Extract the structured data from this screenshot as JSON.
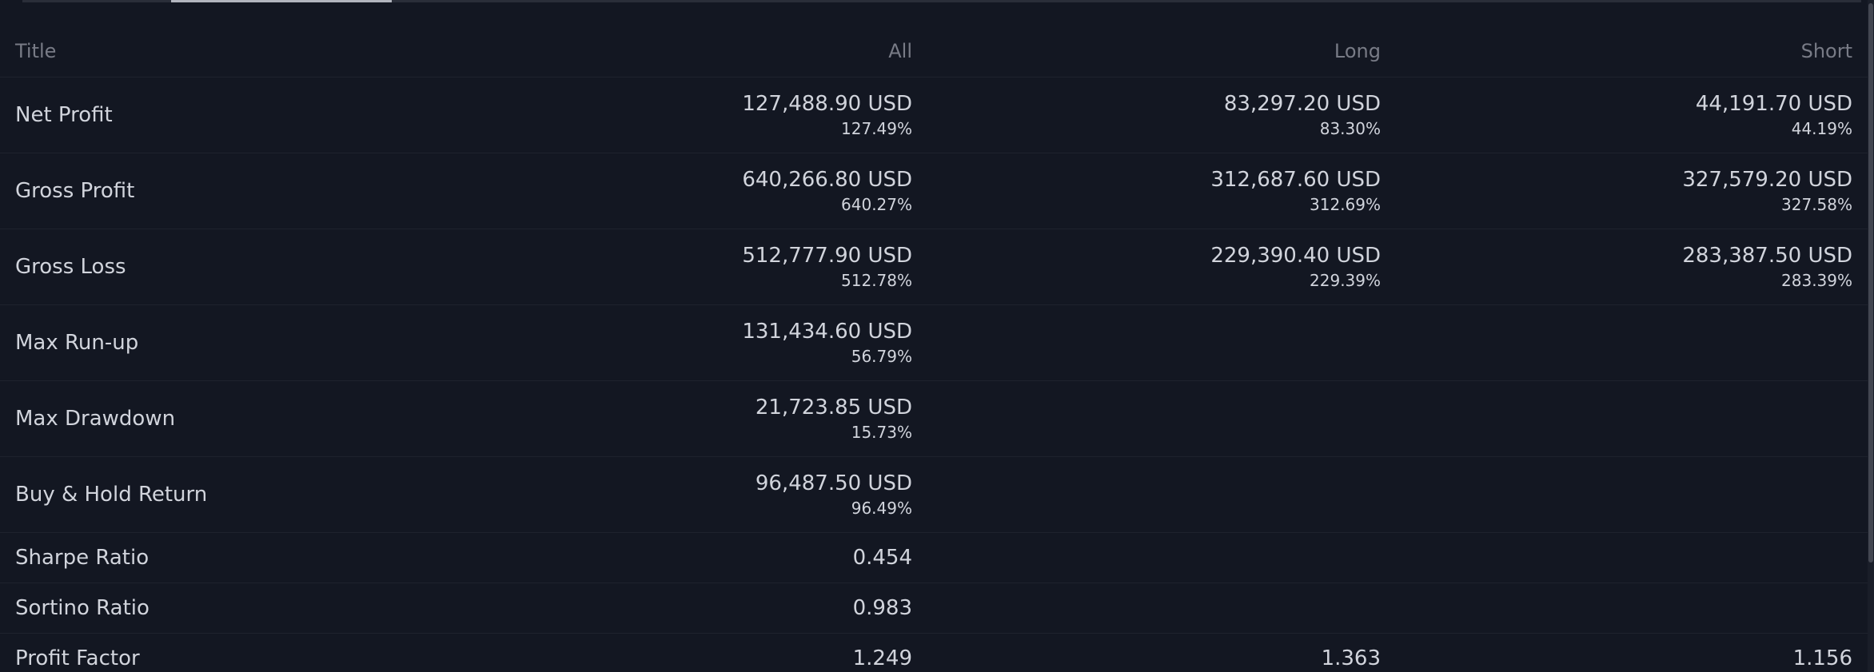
{
  "header": {
    "title": "Title",
    "all": "All",
    "long": "Long",
    "short": "Short"
  },
  "rows": [
    {
      "title": "Net Profit",
      "all": {
        "value": "127,488.90 USD",
        "pct": "127.49%"
      },
      "long": {
        "value": "83,297.20 USD",
        "pct": "83.30%"
      },
      "short": {
        "value": "44,191.70 USD",
        "pct": "44.19%"
      }
    },
    {
      "title": "Gross Profit",
      "all": {
        "value": "640,266.80 USD",
        "pct": "640.27%"
      },
      "long": {
        "value": "312,687.60 USD",
        "pct": "312.69%"
      },
      "short": {
        "value": "327,579.20 USD",
        "pct": "327.58%"
      }
    },
    {
      "title": "Gross Loss",
      "all": {
        "value": "512,777.90 USD",
        "pct": "512.78%"
      },
      "long": {
        "value": "229,390.40 USD",
        "pct": "229.39%"
      },
      "short": {
        "value": "283,387.50 USD",
        "pct": "283.39%"
      }
    },
    {
      "title": "Max Run-up",
      "all": {
        "value": "131,434.60 USD",
        "pct": "56.79%"
      }
    },
    {
      "title": "Max Drawdown",
      "all": {
        "value": "21,723.85 USD",
        "pct": "15.73%"
      }
    },
    {
      "title": "Buy & Hold Return",
      "all": {
        "value": "96,487.50 USD",
        "pct": "96.49%"
      }
    },
    {
      "title": "Sharpe Ratio",
      "all": {
        "value": "0.454"
      }
    },
    {
      "title": "Sortino Ratio",
      "all": {
        "value": "0.983"
      }
    },
    {
      "title": "Profit Factor",
      "all": {
        "value": "1.249"
      },
      "long": {
        "value": "1.363"
      },
      "short": {
        "value": "1.156"
      }
    }
  ],
  "colors": {
    "background": "#131722",
    "text": "#d1d4dc",
    "header_text": "#787b86",
    "divider": "#1e222d"
  }
}
